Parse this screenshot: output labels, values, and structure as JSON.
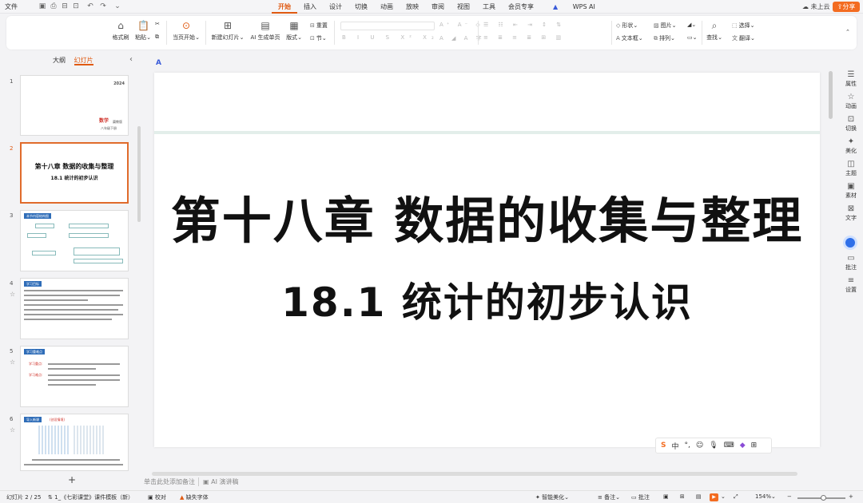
{
  "menubar": {
    "file": "文件",
    "menus": [
      "开始",
      "插入",
      "设计",
      "切换",
      "动画",
      "放映",
      "审阅",
      "视图",
      "工具",
      "会员专享",
      "WPS AI"
    ],
    "active": "开始",
    "unsaved": "未上云",
    "share": "分享"
  },
  "ribbon": {
    "format_painter": "格式刷",
    "paste": "粘贴",
    "from_current": "当页开始",
    "new_slide": "新建幻灯片",
    "ai_generate": "AI 生成单页",
    "layout": "版式",
    "reset": "重置",
    "section": "节",
    "shape": "形状",
    "picture": "图片",
    "textbox": "文本框",
    "arrange": "排列",
    "find": "查找",
    "select": "选择",
    "translate": "翻译"
  },
  "left_panel": {
    "tabs": [
      "大纲",
      "幻灯片"
    ],
    "active_tab": "幻灯片",
    "slides": [
      {
        "num": "1",
        "year": "2024",
        "subject": "数学",
        "publisher": "冀教版",
        "grade": "八年级下册"
      },
      {
        "num": "2",
        "line1": "第十八章  数据的收集与整理",
        "line2": "18.1  统计的初步认识"
      },
      {
        "num": "3",
        "heading": "本节内容结构图"
      },
      {
        "num": "4",
        "heading": "学习目标"
      },
      {
        "num": "5",
        "heading": "学习重难点",
        "key": "学习重点:",
        "diff": "学习难点:"
      },
      {
        "num": "6",
        "heading": "导入新课",
        "tag": "(创设情境)"
      }
    ]
  },
  "slide": {
    "title": "第十八章  数据的收集与整理",
    "subtitle": "18.1  统计的初步认识"
  },
  "notes": {
    "placeholder": "单击此处添加备注",
    "ai_notes": "AI 演讲稿"
  },
  "right_panel": [
    "属性",
    "动画",
    "切换",
    "美化",
    "主题",
    "素材",
    "文字",
    "批注",
    "设置"
  ],
  "status": {
    "slide_count": "幻灯片 2 / 25",
    "template": "1_《七彩课堂》课件模板（新）",
    "proof": "校对",
    "missing_font": "缺失字体",
    "smart_beautify": "智能美化",
    "notes": "备注",
    "comments": "批注",
    "zoom": "154%"
  }
}
